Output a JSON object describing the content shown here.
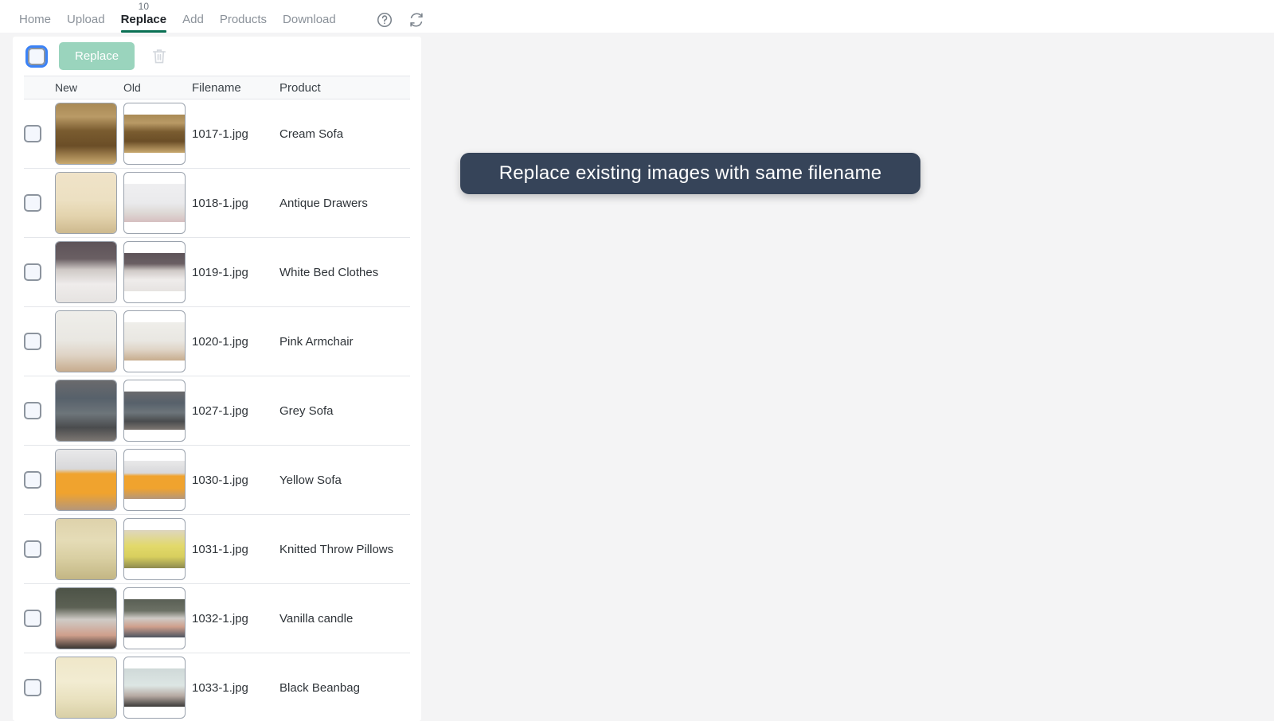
{
  "nav": {
    "items": [
      {
        "label": "Home",
        "active": false,
        "badge": ""
      },
      {
        "label": "Upload",
        "active": false,
        "badge": ""
      },
      {
        "label": "Replace",
        "active": true,
        "badge": "10"
      },
      {
        "label": "Add",
        "active": false,
        "badge": ""
      },
      {
        "label": "Products",
        "active": false,
        "badge": ""
      },
      {
        "label": "Download",
        "active": false,
        "badge": ""
      }
    ],
    "icons": [
      {
        "name": "help-icon",
        "title": "Help"
      },
      {
        "name": "refresh-icon",
        "title": "Refresh"
      }
    ],
    "active_underline_color": "#0a7054"
  },
  "toolbar": {
    "select_all_checked": false,
    "replace_label": "Replace",
    "replace_button_color": "#9ad4bd",
    "delete_icon": "trash-icon",
    "delete_enabled": false
  },
  "table": {
    "columns": [
      "New",
      "Old",
      "Filename",
      "Product"
    ],
    "rows": [
      {
        "checked": false,
        "filename": "1017-1.jpg",
        "product": "Cream Sofa",
        "new_thumb": "cream-sofa-new",
        "old_thumb": "cream-sofa-old"
      },
      {
        "checked": false,
        "filename": "1018-1.jpg",
        "product": "Antique Drawers",
        "new_thumb": "antique-drawers-new",
        "old_thumb": "antique-drawers-old"
      },
      {
        "checked": false,
        "filename": "1019-1.jpg",
        "product": "White Bed Clothes",
        "new_thumb": "white-bed-clothes-new",
        "old_thumb": "white-bed-clothes-old"
      },
      {
        "checked": false,
        "filename": "1020-1.jpg",
        "product": "Pink Armchair",
        "new_thumb": "pink-armchair-new",
        "old_thumb": "pink-armchair-old"
      },
      {
        "checked": false,
        "filename": "1027-1.jpg",
        "product": "Grey Sofa",
        "new_thumb": "grey-sofa-new",
        "old_thumb": "grey-sofa-old"
      },
      {
        "checked": false,
        "filename": "1030-1.jpg",
        "product": "Yellow Sofa",
        "new_thumb": "yellow-sofa-new",
        "old_thumb": "yellow-sofa-old"
      },
      {
        "checked": false,
        "filename": "1031-1.jpg",
        "product": "Knitted Throw Pillows",
        "new_thumb": "knitted-throw-pillows-new",
        "old_thumb": "knitted-throw-pillows-old"
      },
      {
        "checked": false,
        "filename": "1032-1.jpg",
        "product": "Vanilla candle",
        "new_thumb": "vanilla-candle-new",
        "old_thumb": "vanilla-candle-old"
      },
      {
        "checked": false,
        "filename": "1033-1.jpg",
        "product": "Black Beanbag",
        "new_thumb": "black-beanbag-new",
        "old_thumb": "black-beanbag-old"
      }
    ]
  },
  "tooltip": {
    "text": "Replace existing images with same filename",
    "background": "#364459",
    "text_color": "#ffffff"
  },
  "theme": {
    "page_background": "#f4f4f5",
    "panel_background": "#ffffff",
    "focus_ring": "#3b82f6"
  }
}
